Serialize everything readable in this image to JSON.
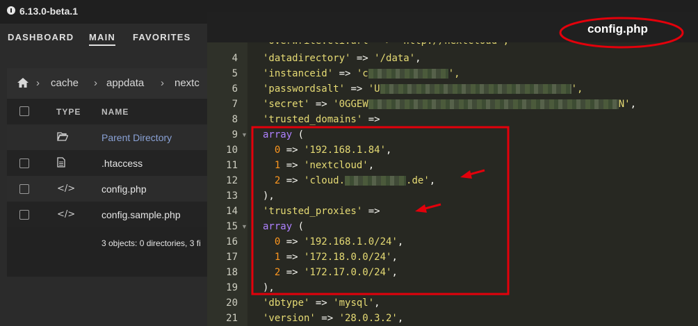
{
  "app": {
    "version": "6.13.0-beta.1"
  },
  "nav": {
    "items": [
      "DASHBOARD",
      "MAIN",
      "FAVORITES"
    ]
  },
  "filebrowser": {
    "breadcrumb": [
      "cache",
      "appdata",
      "nextc"
    ],
    "columns": {
      "type": "TYPE",
      "name": "NAME"
    },
    "rows": [
      {
        "icon": "folder-open-icon",
        "name": "Parent Directory"
      },
      {
        "icon": "file-text-icon",
        "name": ".htaccess"
      },
      {
        "icon": "code-icon",
        "name": "config.php"
      },
      {
        "icon": "code-icon",
        "name": "config.sample.php"
      }
    ],
    "summary": "3 objects: 0 directories, 3 fi"
  },
  "editor": {
    "title": "config.php",
    "lines": [
      {
        "n": "4",
        "parts": [
          {
            "t": "'datadirectory'",
            "c": "s"
          },
          {
            "t": " => ",
            "c": "p"
          },
          {
            "t": "'/data'",
            "c": "s"
          },
          {
            "t": ",",
            "c": "p"
          }
        ]
      },
      {
        "n": "5",
        "parts": [
          {
            "t": "'instanceid'",
            "c": "s"
          },
          {
            "t": " => ",
            "c": "p"
          },
          {
            "t": "'c",
            "c": "s"
          },
          {
            "t": "",
            "c": "blur",
            "w": 115
          },
          {
            "t": "',",
            "c": "s"
          }
        ]
      },
      {
        "n": "6",
        "parts": [
          {
            "t": "'passwordsalt'",
            "c": "s"
          },
          {
            "t": " => ",
            "c": "p"
          },
          {
            "t": "'U",
            "c": "s"
          },
          {
            "t": "",
            "c": "blur",
            "w": 275
          },
          {
            "t": "',",
            "c": "s"
          }
        ]
      },
      {
        "n": "7",
        "parts": [
          {
            "t": "'secret'",
            "c": "s"
          },
          {
            "t": " => ",
            "c": "p"
          },
          {
            "t": "'0GGEW",
            "c": "s"
          },
          {
            "t": "",
            "c": "blur",
            "w": 360
          },
          {
            "t": "N'",
            "c": "s"
          },
          {
            "t": ",",
            "c": "p"
          }
        ]
      },
      {
        "n": "8",
        "parts": [
          {
            "t": "'trusted_domains'",
            "c": "s"
          },
          {
            "t": " =>",
            "c": "p"
          }
        ]
      },
      {
        "n": "9",
        "fold": true,
        "parts": [
          {
            "t": "array",
            "c": "k"
          },
          {
            "t": " (",
            "c": "p"
          }
        ]
      },
      {
        "n": "10",
        "parts": [
          {
            "t": "  ",
            "c": "p"
          },
          {
            "t": "0",
            "c": "n"
          },
          {
            "t": " => ",
            "c": "p"
          },
          {
            "t": "'192.168.1.84'",
            "c": "s"
          },
          {
            "t": ",",
            "c": "p"
          }
        ]
      },
      {
        "n": "11",
        "parts": [
          {
            "t": "  ",
            "c": "p"
          },
          {
            "t": "1",
            "c": "n"
          },
          {
            "t": " => ",
            "c": "p"
          },
          {
            "t": "'nextcloud'",
            "c": "s"
          },
          {
            "t": ",",
            "c": "p"
          }
        ]
      },
      {
        "n": "12",
        "parts": [
          {
            "t": "  ",
            "c": "p"
          },
          {
            "t": "2",
            "c": "n"
          },
          {
            "t": " => ",
            "c": "p"
          },
          {
            "t": "'cloud.",
            "c": "s"
          },
          {
            "t": "",
            "c": "blur",
            "w": 88
          },
          {
            "t": ".de'",
            "c": "s"
          },
          {
            "t": ",",
            "c": "p"
          }
        ]
      },
      {
        "n": "13",
        "parts": [
          {
            "t": "),",
            "c": "p"
          }
        ]
      },
      {
        "n": "14",
        "parts": [
          {
            "t": "'trusted_proxies'",
            "c": "s"
          },
          {
            "t": " =>",
            "c": "p"
          }
        ]
      },
      {
        "n": "15",
        "fold": true,
        "parts": [
          {
            "t": "array",
            "c": "k"
          },
          {
            "t": " (",
            "c": "p"
          }
        ]
      },
      {
        "n": "16",
        "parts": [
          {
            "t": "  ",
            "c": "p"
          },
          {
            "t": "0",
            "c": "n"
          },
          {
            "t": " => ",
            "c": "p"
          },
          {
            "t": "'192.168.1.0/24'",
            "c": "s"
          },
          {
            "t": ",",
            "c": "p"
          }
        ]
      },
      {
        "n": "17",
        "parts": [
          {
            "t": "  ",
            "c": "p"
          },
          {
            "t": "1",
            "c": "n"
          },
          {
            "t": " => ",
            "c": "p"
          },
          {
            "t": "'172.18.0.0/24'",
            "c": "s"
          },
          {
            "t": ",",
            "c": "p"
          }
        ]
      },
      {
        "n": "18",
        "parts": [
          {
            "t": "  ",
            "c": "p"
          },
          {
            "t": "2",
            "c": "n"
          },
          {
            "t": " => ",
            "c": "p"
          },
          {
            "t": "'172.17.0.0/24'",
            "c": "s"
          },
          {
            "t": ",",
            "c": "p"
          }
        ]
      },
      {
        "n": "19",
        "parts": [
          {
            "t": "),",
            "c": "p"
          }
        ]
      },
      {
        "n": "20",
        "parts": [
          {
            "t": "'dbtype'",
            "c": "s"
          },
          {
            "t": " => ",
            "c": "p"
          },
          {
            "t": "'mysql'",
            "c": "s"
          },
          {
            "t": ",",
            "c": "p"
          }
        ]
      },
      {
        "n": "21",
        "parts": [
          {
            "t": "'version'",
            "c": "s"
          },
          {
            "t": " => ",
            "c": "p"
          },
          {
            "t": "'28.0.3.2'",
            "c": "s"
          },
          {
            "t": ",",
            "c": "p"
          }
        ]
      }
    ]
  },
  "annotations": {
    "color": "#e3000b"
  }
}
